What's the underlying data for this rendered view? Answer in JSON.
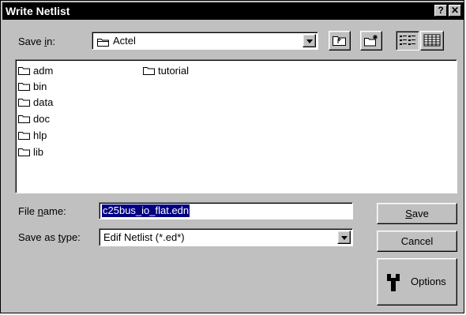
{
  "dialog": {
    "title": "Write Netlist",
    "help_label": "?",
    "close_label": "✕"
  },
  "save_in": {
    "label_pre": "Save ",
    "label_key": "i",
    "label_post": "n:",
    "value": "Actel"
  },
  "files": [
    {
      "name": "adm"
    },
    {
      "name": "bin"
    },
    {
      "name": "data"
    },
    {
      "name": "doc"
    },
    {
      "name": "hlp"
    },
    {
      "name": "lib"
    },
    {
      "name": "tutorial"
    }
  ],
  "file_name": {
    "label_pre": "File ",
    "label_key": "n",
    "label_post": "ame:",
    "value": "c25bus_io_flat.edn"
  },
  "save_as_type": {
    "label_pre": "Save as ",
    "label_key": "t",
    "label_post": "ype:",
    "value": "Edif Netlist (*.ed*)"
  },
  "buttons": {
    "save_key": "S",
    "save_rest": "ave",
    "cancel": "Cancel",
    "options": "Options"
  },
  "icons": {
    "folder": "folder-icon",
    "up_one_level": "up-folder-icon",
    "new_folder": "new-folder-icon",
    "list_view": "list-view-icon",
    "details_view": "details-view-icon",
    "options": "wrench-icon"
  }
}
